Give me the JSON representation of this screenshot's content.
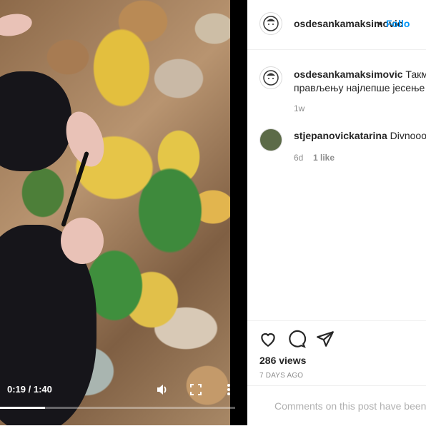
{
  "video": {
    "time_display": "0:19 / 1:40",
    "progress_fraction": 0.19,
    "icons": {
      "volume": "volume-icon",
      "fullscreen": "fullscreen-icon",
      "more": "more-vertical-icon"
    }
  },
  "header": {
    "username": "osdesankamaksimovic",
    "separator": "•",
    "follow_label": "Follo"
  },
  "comments": [
    {
      "username": "osdesankamaksimovic",
      "text_line1": "Такми",
      "text_line2": "прављењу најлепше јесење ",
      "time": "1w"
    },
    {
      "username": "stjepanovickatarina",
      "text": "Divnooo!",
      "time": "6d",
      "likes": "1 like"
    }
  ],
  "post": {
    "views": "286 views",
    "date": "7 DAYS AGO",
    "comments_closed": "Comments on this post have been",
    "icons": {
      "like": "heart-icon",
      "comment": "comment-icon",
      "share": "share-icon"
    }
  },
  "colors": {
    "link": "#0095f6",
    "text": "#262626",
    "muted": "#8e8e8e"
  }
}
